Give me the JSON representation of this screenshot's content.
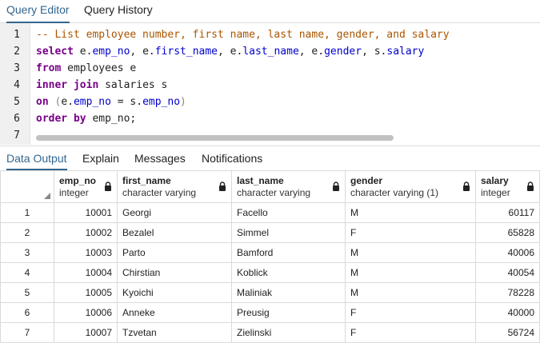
{
  "editor_tabs": [
    "Query Editor",
    "Query History"
  ],
  "editor": {
    "line_numbers": [
      "1",
      "2",
      "3",
      "4",
      "5",
      "6",
      "7"
    ],
    "line1": {
      "comment": "-- List employee number, first name, last name, gender, and salary"
    },
    "line2": {
      "kw": "select",
      "t1": " e.",
      "p1": "emp_no",
      "t2": ", e.",
      "p2": "first_name",
      "t3": ", e.",
      "p3": "last_name",
      "t4": ", e.",
      "p4": "gender",
      "t5": ", s.",
      "p5": "salary"
    },
    "line3": {
      "kw": "from",
      "rest": " employees e"
    },
    "line4": {
      "kw": "inner join",
      "rest": " salaries s"
    },
    "line5": {
      "kw": "on",
      "paren_open": " (",
      "t1": "e.",
      "p1": "emp_no",
      "t2": " = s.",
      "p2": "emp_no",
      "paren_close": ")"
    },
    "line6": {
      "kw": "order by",
      "rest": " emp_no;"
    }
  },
  "result_tabs": [
    "Data Output",
    "Explain",
    "Messages",
    "Notifications"
  ],
  "columns": [
    {
      "name": "emp_no",
      "type": "integer"
    },
    {
      "name": "first_name",
      "type": "character varying"
    },
    {
      "name": "last_name",
      "type": "character varying"
    },
    {
      "name": "gender",
      "type": "character varying (1)"
    },
    {
      "name": "salary",
      "type": "integer"
    }
  ],
  "rows": [
    {
      "n": "1",
      "emp_no": "10001",
      "first_name": "Georgi",
      "last_name": "Facello",
      "gender": "M",
      "salary": "60117"
    },
    {
      "n": "2",
      "emp_no": "10002",
      "first_name": "Bezalel",
      "last_name": "Simmel",
      "gender": "F",
      "salary": "65828"
    },
    {
      "n": "3",
      "emp_no": "10003",
      "first_name": "Parto",
      "last_name": "Bamford",
      "gender": "M",
      "salary": "40006"
    },
    {
      "n": "4",
      "emp_no": "10004",
      "first_name": "Chirstian",
      "last_name": "Koblick",
      "gender": "M",
      "salary": "40054"
    },
    {
      "n": "5",
      "emp_no": "10005",
      "first_name": "Kyoichi",
      "last_name": "Maliniak",
      "gender": "M",
      "salary": "78228"
    },
    {
      "n": "6",
      "emp_no": "10006",
      "first_name": "Anneke",
      "last_name": "Preusig",
      "gender": "F",
      "salary": "40000"
    },
    {
      "n": "7",
      "emp_no": "10007",
      "first_name": "Tzvetan",
      "last_name": "Zielinski",
      "gender": "F",
      "salary": "56724"
    }
  ],
  "colors": {
    "accent": "#326690",
    "keyword": "#770088",
    "comment": "#aa5500",
    "property": "#0000cc"
  }
}
